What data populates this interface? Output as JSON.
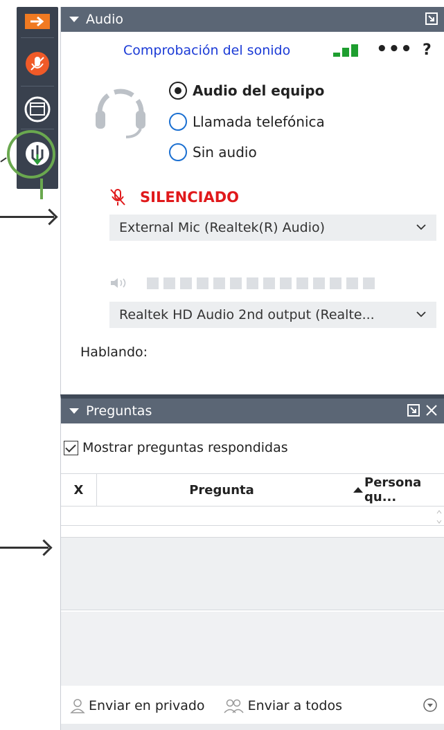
{
  "audio_panel": {
    "title": "Audio",
    "sound_check_link": "Comprobación del sonido",
    "more": "•••",
    "help": "?",
    "options": [
      {
        "label": "Audio del equipo",
        "selected": true
      },
      {
        "label": "Llamada telefónica",
        "selected": false
      },
      {
        "label": "Sin audio",
        "selected": false
      }
    ],
    "mute_status": "SILENCIADO",
    "microphone_select": "External Mic (Realtek(R) Audio)",
    "speaker_select": "Realtek HD Audio 2nd output (Realte...",
    "talking_label": "Hablando:",
    "signal_color": "#1e9e2f",
    "mute_color": "#e0191b"
  },
  "questions_panel": {
    "title": "Preguntas",
    "show_answered": "Mostrar preguntas respondidas",
    "show_answered_checked": true,
    "columns": {
      "x": "X",
      "question": "Pregunta",
      "person": "Persona qu..."
    },
    "send_private": "Enviar en privado",
    "send_all": "Enviar a todos"
  },
  "toolbar": {
    "icons": [
      "arrow-right-icon",
      "microphone-icon",
      "window-icon",
      "raise-hand-icon"
    ],
    "accent": "#f07a22",
    "highlight": "#6aa84f"
  }
}
